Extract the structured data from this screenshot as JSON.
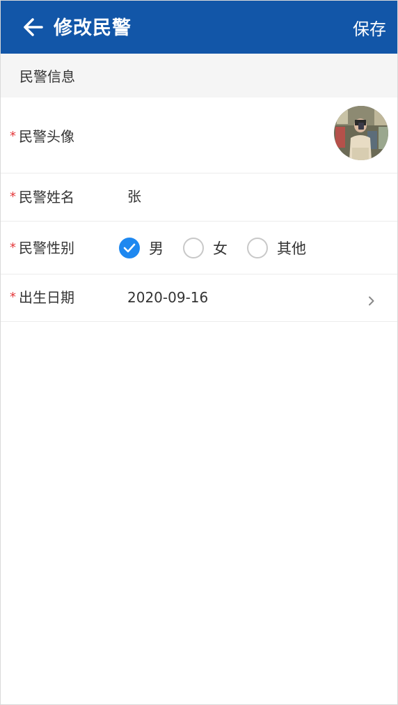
{
  "header": {
    "title": "修改民警",
    "save_label": "保存",
    "back_icon": "arrow-left-icon"
  },
  "section": {
    "title": "民警信息"
  },
  "form": {
    "required_mark": "*",
    "avatar": {
      "label": "民警头像"
    },
    "name": {
      "label": "民警姓名",
      "value": "张"
    },
    "gender": {
      "label": "民警性别",
      "options": [
        "男",
        "女",
        "其他"
      ],
      "selected": "男"
    },
    "birth": {
      "label": "出生日期",
      "value": "2020-09-16"
    }
  },
  "colors": {
    "header_bg": "#1256a8",
    "accent": "#1e88f0",
    "required": "#e4393c"
  }
}
